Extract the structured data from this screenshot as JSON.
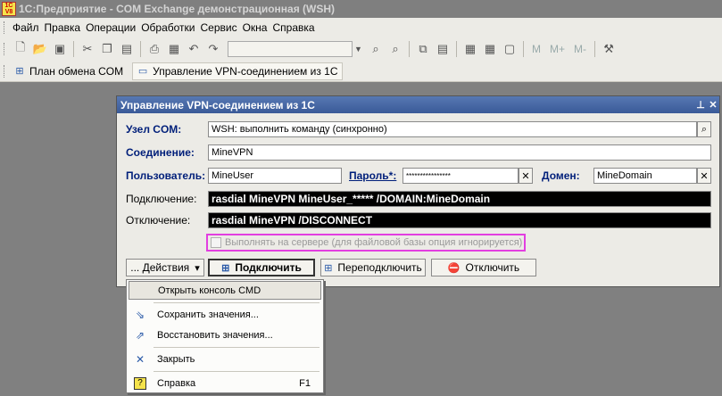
{
  "app": {
    "title": "1С:Предприятие - COM Exchange демонстрационная (WSH)",
    "logo_text": "1С V8"
  },
  "menu": [
    "Файл",
    "Правка",
    "Операции",
    "Обработки",
    "Сервис",
    "Окна",
    "Справка"
  ],
  "toolbar": {
    "texts": [
      "M",
      "M+",
      "M-"
    ]
  },
  "panel": {
    "items": [
      "План обмена COM",
      "Управление VPN-соединением из 1С"
    ]
  },
  "window": {
    "title": "Управление VPN-соединением из 1С",
    "fields": {
      "node_label": "Узел COM:",
      "node_value": "WSH: выполнить команду (синхронно)",
      "conn_label": "Соединение:",
      "conn_value": "MineVPN",
      "user_label": "Пользователь:",
      "user_value": "MineUser",
      "pass_label": "Пароль*:",
      "pass_value": "****************",
      "domain_label": "Домен:",
      "domain_value": "MineDomain",
      "connect_label": "Подключение:",
      "connect_value": "rasdial MineVPN MineUser_***** /DOMAIN:MineDomain",
      "disconnect_label": "Отключение:",
      "disconnect_value": "rasdial MineVPN /DISCONNECT"
    },
    "checkbox_label": "Выполнять на сервере (для файловой базы опция игнорируется)",
    "buttons": {
      "actions": "... Действия",
      "connect": "Подключить",
      "reconnect": "Переподключить",
      "disconnect": "Отключить"
    }
  },
  "dropdown": {
    "items": [
      {
        "label": "Открыть консоль CMD",
        "key": ""
      },
      {
        "label": "Сохранить значения...",
        "key": ""
      },
      {
        "label": "Восстановить значения...",
        "key": ""
      },
      {
        "label": "Закрыть",
        "key": ""
      },
      {
        "label": "Справка",
        "key": "F1"
      }
    ]
  }
}
